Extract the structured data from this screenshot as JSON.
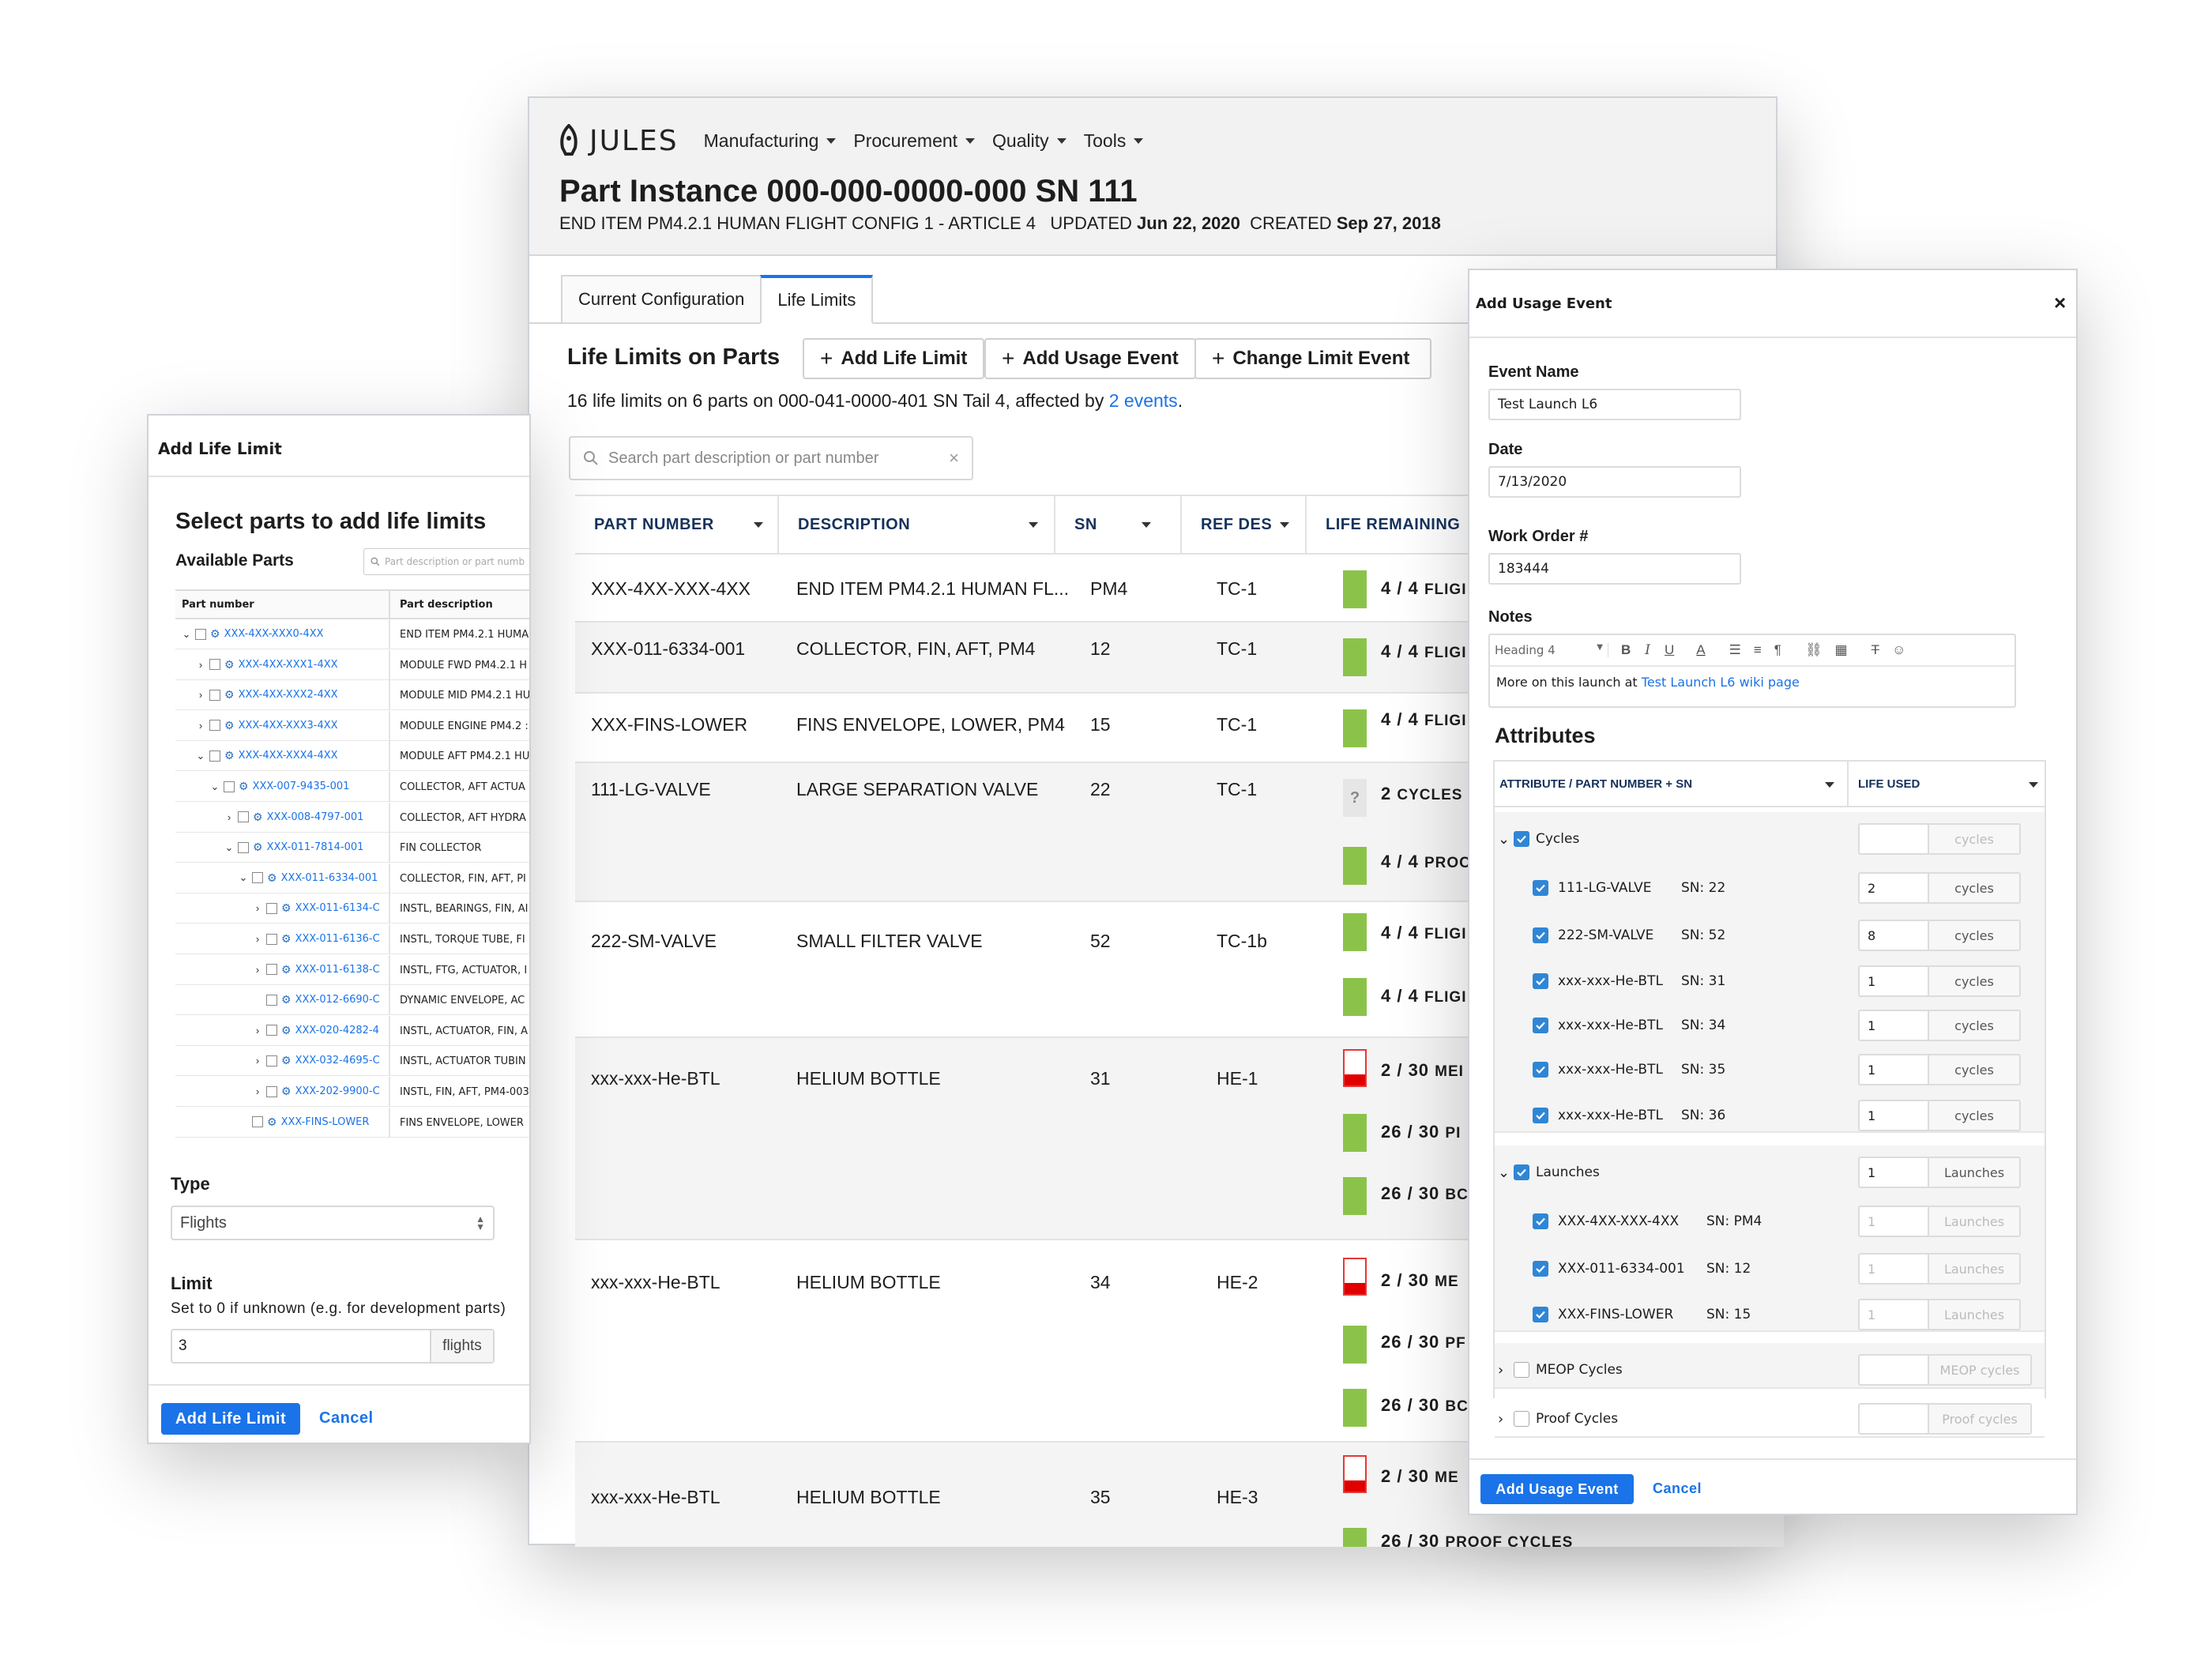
{
  "main": {
    "logo_text": "JULES",
    "nav": [
      "Manufacturing",
      "Procurement",
      "Quality",
      "Tools"
    ],
    "title": "Part Instance 000-000-0000-000 SN 111",
    "subtitle_prefix": "END ITEM PM4.2.1 HUMAN FLIGHT CONFIG 1 - ARTICLE 4   UPDATED ",
    "updated": "Jun 22, 2020",
    "created_label": "CREATED ",
    "created": "Sep 27, 2018",
    "tabs": [
      "Current Configuration",
      "Life Limits"
    ],
    "section_title": "Life Limits on Parts",
    "actions": [
      "Add Life Limit",
      "Add Usage Event",
      "Change Limit Event"
    ],
    "summary_prefix": "16 life limits on 6 parts on 000-041-0000-401 SN Tail 4, affected by ",
    "summary_link": "2 events",
    "summary_suffix": ".",
    "search_placeholder": "Search part description or part number",
    "columns": [
      "PART NUMBER",
      "DESCRIPTION",
      "SN",
      "REF DES",
      "LIFE REMAINING"
    ],
    "rows": [
      {
        "pn": "XXX-4XX-XXX-4XX",
        "desc": "END ITEM PM4.2.1 HUMAN FL...",
        "sn": "PM4",
        "ref": "TC-1"
      },
      {
        "pn": "XXX-011-6334-001",
        "desc": "COLLECTOR, FIN, AFT, PM4",
        "sn": "12",
        "ref": "TC-1"
      },
      {
        "pn": "XXX-FINS-LOWER",
        "desc": "FINS ENVELOPE, LOWER, PM4",
        "sn": "15",
        "ref": "TC-1"
      },
      {
        "pn": "111-LG-VALVE",
        "desc": "LARGE SEPARATION VALVE",
        "sn": "22",
        "ref": "TC-1"
      },
      {
        "pn": "222-SM-VALVE",
        "desc": "SMALL FILTER VALVE",
        "sn": "52",
        "ref": "TC-1b"
      },
      {
        "pn": "xxx-xxx-He-BTL",
        "desc": "HELIUM BOTTLE",
        "sn": "31",
        "ref": "HE-1"
      },
      {
        "pn": "xxx-xxx-He-BTL",
        "desc": "HELIUM BOTTLE",
        "sn": "34",
        "ref": "HE-2"
      },
      {
        "pn": "xxx-xxx-He-BTL",
        "desc": "HELIUM BOTTLE",
        "sn": "35",
        "ref": "HE-3"
      }
    ],
    "life": [
      {
        "value": "4 / 4",
        "unit": "FLIGI"
      },
      {
        "value": "4 / 4",
        "unit": "FLIGI"
      },
      {
        "value": "4 / 4",
        "unit": "FLIGI"
      },
      {
        "value": "2",
        "unit": "CYCLES",
        "icon": "?"
      },
      {
        "value": "4 / 4",
        "unit": "PROC"
      },
      {
        "value": "4 / 4",
        "unit": "FLIGI"
      },
      {
        "value": "4 / 4",
        "unit": "FLIGI"
      },
      {
        "value": "2 / 30",
        "unit": "MEI"
      },
      {
        "value": "26 / 30",
        "unit": "PI"
      },
      {
        "value": "26 / 30",
        "unit": "BC"
      },
      {
        "value": "2 / 30",
        "unit": "ME"
      },
      {
        "value": "26 / 30",
        "unit": "PF"
      },
      {
        "value": "26 / 30",
        "unit": "BC"
      },
      {
        "value": "2 / 30",
        "unit": "ME"
      },
      {
        "value": "26 / 30",
        "unit": "PROOF CYCLES"
      }
    ]
  },
  "life_limit_modal": {
    "title": "Add Life Limit",
    "heading": "Select parts to add life limits",
    "available_label": "Available Parts",
    "search_placeholder": "Part description or part numb",
    "tree_headers": [
      "Part number",
      "Part description"
    ],
    "tree": [
      {
        "pn": "XXX-4XX-XXX0-4XX",
        "desc": "END ITEM PM4.2.1 HUMA"
      },
      {
        "pn": "XXX-4XX-XXX1-4XX",
        "desc": "MODULE FWD PM4.2.1 H"
      },
      {
        "pn": "XXX-4XX-XXX2-4XX",
        "desc": "MODULE MID PM4.2.1 HU"
      },
      {
        "pn": "XXX-4XX-XXX3-4XX",
        "desc": "MODULE ENGINE PM4.2 :"
      },
      {
        "pn": "XXX-4XX-XXX4-4XX",
        "desc": "MODULE AFT PM4.2.1 HU"
      },
      {
        "pn": "XXX-007-9435-001",
        "desc": "COLLECTOR, AFT ACTUA"
      },
      {
        "pn": "XXX-008-4797-001",
        "desc": "COLLECTOR, AFT HYDRA"
      },
      {
        "pn": "XXX-011-7814-001",
        "desc": "FIN COLLECTOR"
      },
      {
        "pn": "XXX-011-6334-001",
        "desc": "COLLECTOR, FIN, AFT, PI"
      },
      {
        "pn": "XXX-011-6134-C",
        "desc": "INSTL, BEARINGS, FIN, AI"
      },
      {
        "pn": "XXX-011-6136-C",
        "desc": "INSTL, TORQUE TUBE, FI"
      },
      {
        "pn": "XXX-011-6138-C",
        "desc": "INSTL, FTG, ACTUATOR, I"
      },
      {
        "pn": "XXX-012-6690-C",
        "desc": "DYNAMIC ENVELOPE, AC"
      },
      {
        "pn": "XXX-020-4282-4",
        "desc": "INSTL, ACTUATOR, FIN, A"
      },
      {
        "pn": "XXX-032-4695-C",
        "desc": "INSTL, ACTUATOR TUBIN"
      },
      {
        "pn": "XXX-202-9900-C",
        "desc": "INSTL, FIN, AFT, PM4-003"
      },
      {
        "pn": "XXX-FINS-LOWER",
        "desc": "FINS ENVELOPE, LOWER"
      }
    ],
    "type_label": "Type",
    "type_value": "Flights",
    "limit_label": "Limit",
    "limit_help": "Set to 0 if unknown (e.g. for development parts)",
    "limit_value": "3",
    "limit_unit": "flights",
    "submit": "Add Life Limit",
    "cancel": "Cancel"
  },
  "usage_event_modal": {
    "title": "Add Usage Event",
    "event_name_label": "Event Name",
    "event_name": "Test Launch L6",
    "date_label": "Date",
    "date": "7/13/2020",
    "work_order_label": "Work Order #",
    "work_order": "183444",
    "notes_label": "Notes",
    "heading_select": "Heading 4",
    "notes_text": "More on this launch at ",
    "notes_link": "Test Launch L6 wiki page",
    "attributes_label": "Attributes",
    "attr_headers": [
      "ATTRIBUTE / PART NUMBER + SN",
      "LIFE USED"
    ],
    "groups": [
      {
        "name": "Cycles",
        "unit": "cycles",
        "value": "",
        "items": [
          {
            "pn": "111-LG-VALVE",
            "sn": "SN: 22",
            "value": "2"
          },
          {
            "pn": "222-SM-VALVE",
            "sn": "SN: 52",
            "value": "8"
          },
          {
            "pn": "xxx-xxx-He-BTL",
            "sn": "SN: 31",
            "value": "1"
          },
          {
            "pn": "xxx-xxx-He-BTL",
            "sn": "SN: 34",
            "value": "1"
          },
          {
            "pn": "xxx-xxx-He-BTL",
            "sn": "SN: 35",
            "value": "1"
          },
          {
            "pn": "xxx-xxx-He-BTL",
            "sn": "SN: 36",
            "value": "1"
          }
        ]
      },
      {
        "name": "Launches",
        "unit": "Launches",
        "value": "1",
        "items": [
          {
            "pn": "XXX-4XX-XXX-4XX",
            "sn": "SN: PM4",
            "value": "1"
          },
          {
            "pn": "XXX-011-6334-001",
            "sn": "SN: 12",
            "value": "1"
          },
          {
            "pn": "XXX-FINS-LOWER",
            "sn": "SN: 15",
            "value": "1"
          }
        ]
      },
      {
        "name": "MEOP Cycles",
        "unit": "MEOP cycles",
        "value": ""
      },
      {
        "name": "Proof Cycles",
        "unit": "Proof cycles",
        "value": ""
      }
    ],
    "submit": "Add Usage Event",
    "cancel": "Cancel"
  }
}
